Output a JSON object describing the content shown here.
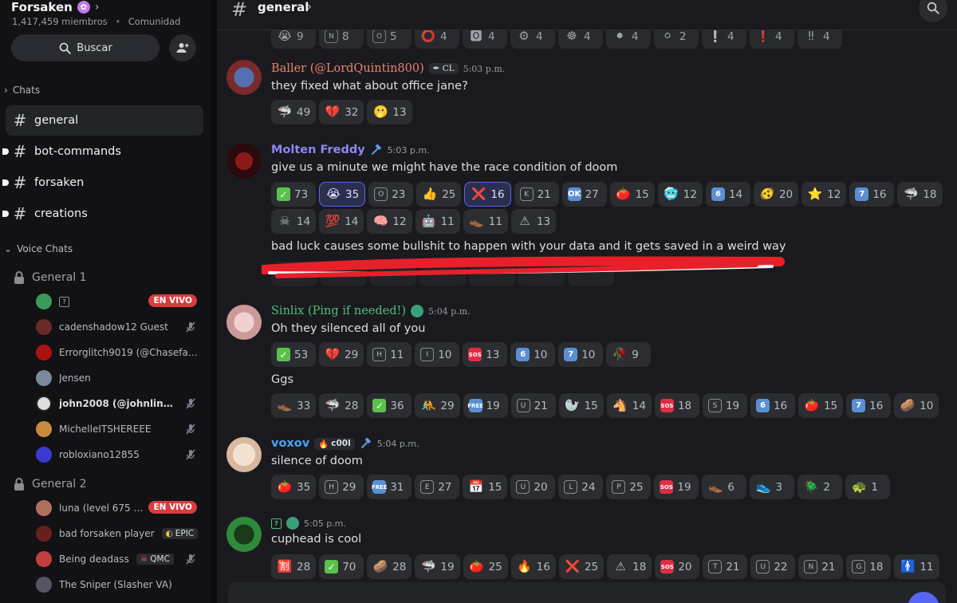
{
  "server": {
    "name": "Forsaken",
    "members": "1,417,459 miembros",
    "dot": "•",
    "community": "Comunidad",
    "search_label": "Buscar"
  },
  "categories": {
    "chats": "Chats",
    "voice": "Voice Chats"
  },
  "channels": [
    {
      "name": "general",
      "active": true
    },
    {
      "name": "bot-commands"
    },
    {
      "name": "forsaken"
    },
    {
      "name": "creations"
    }
  ],
  "voice_channels": [
    {
      "name": "General 1",
      "users": [
        {
          "name": "?",
          "live": "EN VIVO",
          "color": "#3a9a5a"
        },
        {
          "name": "cadenshadow12 Guest",
          "muted": true,
          "color": "#6b2a2a"
        },
        {
          "name": "Errorglitch9019 (@Chasefan1...",
          "color": "#a11"
        },
        {
          "name": "Jensen",
          "color": "#7a8a9a"
        },
        {
          "name": "john2008 (@johnlinguy...",
          "muted": true,
          "color": "#ddd"
        },
        {
          "name": "MichelleITSHEREEE",
          "muted": true,
          "color": "#c98a3a"
        },
        {
          "name": "robloxiano12855",
          "muted": true,
          "color": "#3a3ad0"
        }
      ]
    },
    {
      "name": "General 2",
      "users": [
        {
          "name": "luna (level 675 sla...",
          "live": "EN VIVO",
          "color": "#b07060"
        },
        {
          "name": "bad forsaken player",
          "tag": "EPIC",
          "color": "#6a1f1f"
        },
        {
          "name": "Being deadass",
          "tag": "QMC",
          "muted": true,
          "color": "#c04040"
        },
        {
          "name": "The Sniper (Slasher VA)",
          "color": "#556"
        }
      ]
    }
  ],
  "header": {
    "channel": "general"
  },
  "top_reactions_cut": [
    {
      "emoji": "😭",
      "count": "9"
    },
    {
      "emoji": "N",
      "count": "8"
    },
    {
      "emoji": "O",
      "count": "5"
    },
    {
      "emoji": "⭕",
      "count": "4"
    },
    {
      "emoji": "🅾",
      "count": "4"
    },
    {
      "emoji": "⚙",
      "count": "4"
    },
    {
      "emoji": "☸",
      "count": "4"
    },
    {
      "emoji": "⚫",
      "count": "4"
    },
    {
      "emoji": "⚪",
      "count": "2"
    },
    {
      "emoji": "❕",
      "count": "4"
    },
    {
      "emoji": "❗",
      "count": "4"
    },
    {
      "emoji": "‼",
      "count": "4"
    }
  ],
  "messages": [
    {
      "author": "Baller (@LordQuintin800)",
      "author_color": "#f08070",
      "tag": "CL",
      "time": "5:03 p.m.",
      "text": "they fixed what about office jane?",
      "reactions": [
        [
          {
            "emoji": "🦈",
            "count": "49"
          },
          {
            "emoji": "💔",
            "count": "32"
          },
          {
            "emoji": "🫢",
            "count": "13"
          }
        ]
      ]
    },
    {
      "author": "Molten Freddy",
      "author_color": "#8f86f2",
      "time": "5:03 p.m.",
      "text": "give us a minute we might have the race condition of doom",
      "reactions": [
        [
          {
            "emoji": "✅",
            "count": "73"
          },
          {
            "emoji": "😭",
            "count": "35",
            "me": true
          },
          {
            "emoji": "O",
            "count": "23"
          },
          {
            "emoji": "👍",
            "count": "25"
          },
          {
            "emoji": "❌",
            "count": "16",
            "me": true
          },
          {
            "emoji": "K",
            "count": "21"
          },
          {
            "emoji": "OK",
            "count": "27"
          },
          {
            "emoji": "🍅",
            "count": "15"
          },
          {
            "emoji": "🥶",
            "count": "12"
          },
          {
            "emoji": "6",
            "count": "14"
          },
          {
            "emoji": "🫨",
            "count": "20"
          },
          {
            "emoji": "⭐",
            "count": "12"
          },
          {
            "emoji": "7",
            "count": "16"
          },
          {
            "emoji": "🦈",
            "count": "18"
          }
        ],
        [
          {
            "emoji": "☠",
            "count": "14"
          },
          {
            "emoji": "💯",
            "count": "14"
          },
          {
            "emoji": "🧠",
            "count": "12"
          },
          {
            "emoji": "🤖",
            "count": "11"
          },
          {
            "emoji": "👞",
            "count": "11"
          },
          {
            "emoji": "⚠",
            "count": "13"
          }
        ]
      ],
      "text2": "bad luck causes some bullshit to happen with your data and it gets saved in a weird way"
    },
    {
      "author": "Sinlix (Ping if needed!)",
      "author_color": "#4fbf7a",
      "time": "5:04 p.m.",
      "text": "Oh they silenced all of you",
      "reactions": [
        [
          {
            "emoji": "✅",
            "count": "53"
          },
          {
            "emoji": "💔",
            "count": "29"
          },
          {
            "emoji": "H",
            "count": "11"
          },
          {
            "emoji": "I",
            "count": "10"
          },
          {
            "emoji": "SOS",
            "count": "13"
          },
          {
            "emoji": "6",
            "count": "10"
          },
          {
            "emoji": "7",
            "count": "10"
          },
          {
            "emoji": "🥀",
            "count": "9"
          }
        ]
      ],
      "text2": "Ggs",
      "reactions2": [
        {
          "emoji": "👞",
          "count": "33"
        },
        {
          "emoji": "🦈",
          "count": "28"
        },
        {
          "emoji": "✅",
          "count": "36"
        },
        {
          "emoji": "🤼",
          "count": "29"
        },
        {
          "emoji": "FREE",
          "count": "19"
        },
        {
          "emoji": "U",
          "count": "21"
        },
        {
          "emoji": "🦭",
          "count": "15"
        },
        {
          "emoji": "🐴",
          "count": "14"
        },
        {
          "emoji": "SOS",
          "count": "18"
        },
        {
          "emoji": "S",
          "count": "19"
        },
        {
          "emoji": "6",
          "count": "16"
        },
        {
          "emoji": "🍅",
          "count": "15"
        },
        {
          "emoji": "7",
          "count": "16"
        },
        {
          "emoji": "🥔",
          "count": "10"
        }
      ]
    },
    {
      "author": "voxov",
      "author_color": "#4aa3f0",
      "tag": "c00l",
      "time": "5:04 p.m.",
      "text": "silence of doom",
      "reactions": [
        [
          {
            "emoji": "🍅",
            "count": "35"
          },
          {
            "emoji": "H",
            "count": "29"
          },
          {
            "emoji": "FREE",
            "count": "31"
          },
          {
            "emoji": "E",
            "count": "27"
          },
          {
            "emoji": "📅",
            "count": "15"
          },
          {
            "emoji": "U",
            "count": "20"
          },
          {
            "emoji": "L",
            "count": "24"
          },
          {
            "emoji": "P",
            "count": "25"
          },
          {
            "emoji": "SOS",
            "count": "19"
          },
          {
            "emoji": "👞",
            "count": "6"
          },
          {
            "emoji": "👟",
            "count": "3"
          },
          {
            "emoji": "🪲",
            "count": "2"
          },
          {
            "emoji": "🐢",
            "count": "1"
          }
        ]
      ]
    },
    {
      "author": "?",
      "author_color": "#4fbf7a",
      "time": "5:05 p.m.",
      "text": "cuphead is cool",
      "reactions": [
        [
          {
            "emoji": "🈹",
            "count": "28"
          },
          {
            "emoji": "✅",
            "count": "70"
          },
          {
            "emoji": "🥔",
            "count": "28"
          },
          {
            "emoji": "🦈",
            "count": "19"
          },
          {
            "emoji": "🍅",
            "count": "25"
          },
          {
            "emoji": "🔥",
            "count": "16"
          },
          {
            "emoji": "❌",
            "count": "25"
          },
          {
            "emoji": "⚠",
            "count": "18"
          },
          {
            "emoji": "SOS",
            "count": "20"
          },
          {
            "emoji": "T",
            "count": "21"
          },
          {
            "emoji": "U",
            "count": "22"
          },
          {
            "emoji": "N",
            "count": "21"
          },
          {
            "emoji": "G",
            "count": "18"
          },
          {
            "emoji": "🚹",
            "count": "11"
          }
        ]
      ]
    }
  ],
  "colors": {
    "accent": "#5865f2",
    "live": "#d93c3e",
    "scribble": "#e8202a"
  }
}
